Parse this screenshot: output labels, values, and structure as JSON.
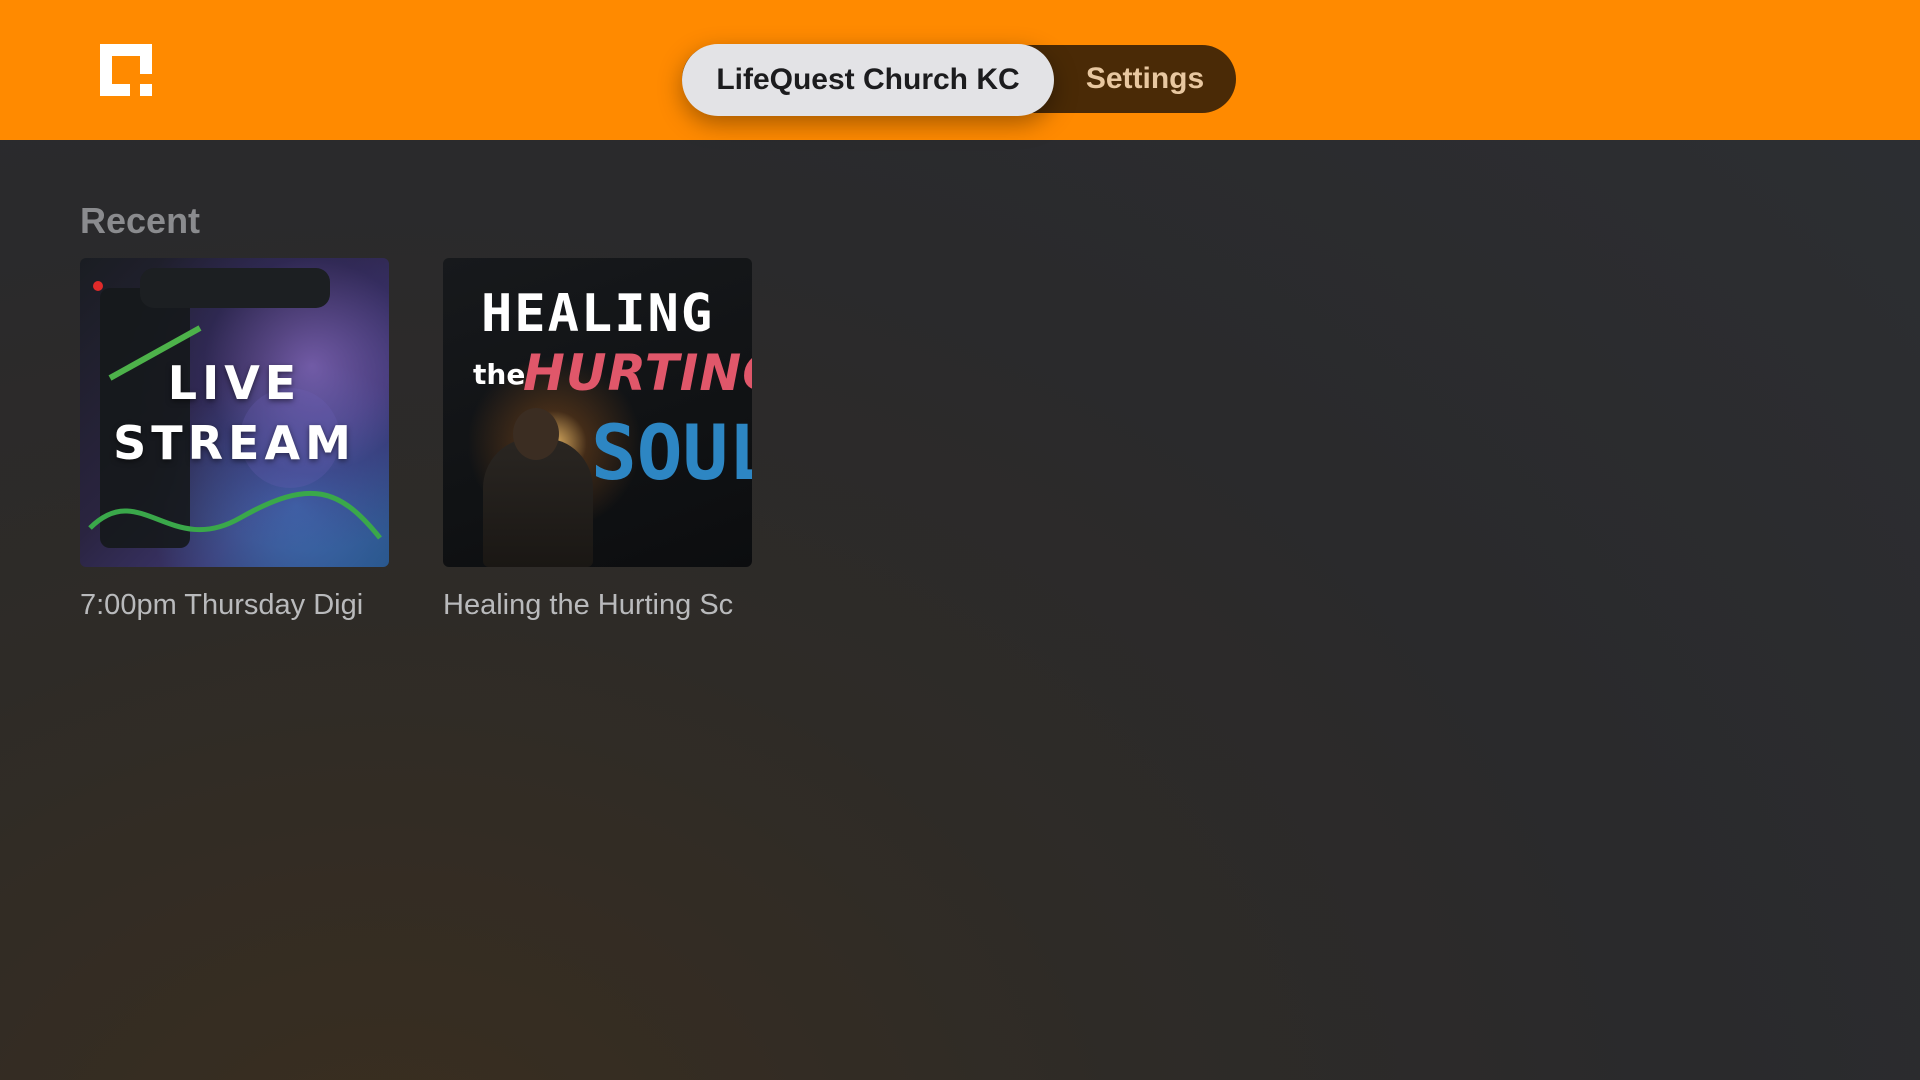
{
  "header": {
    "logo_icon": "app-logo-icon",
    "brand_color": "#ff8a00",
    "tabs": [
      {
        "label": "LifeQuest Church KC",
        "selected": true
      },
      {
        "label": "Settings",
        "selected": false
      }
    ]
  },
  "main": {
    "section_title": "Recent",
    "items": [
      {
        "title": "7:00pm Thursday Digi",
        "artwork_text": [
          "LIVE",
          "STREAM"
        ]
      },
      {
        "title": "Healing the Hurting Sc",
        "artwork_text": [
          "HEALING",
          "the",
          "HURTING",
          "SOUL"
        ]
      }
    ]
  }
}
